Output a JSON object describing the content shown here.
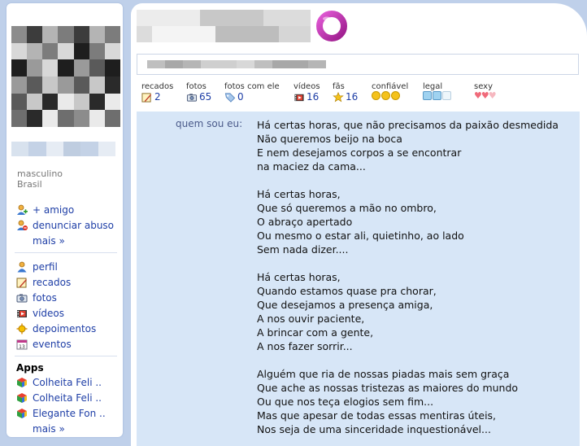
{
  "profile": {
    "gender": "masculino",
    "country": "Brasil"
  },
  "sidebar": {
    "actions": [
      {
        "label": "+ amigo",
        "icon": "add-friend-icon"
      },
      {
        "label": "denunciar abuso",
        "icon": "report-icon"
      },
      {
        "label": "mais »",
        "icon": ""
      }
    ],
    "nav": [
      {
        "label": "perfil",
        "icon": "user-icon"
      },
      {
        "label": "recados",
        "icon": "scrapbook-icon"
      },
      {
        "label": "fotos",
        "icon": "photo-icon"
      },
      {
        "label": "vídeos",
        "icon": "video-icon"
      },
      {
        "label": "depoimentos",
        "icon": "testimonial-icon"
      },
      {
        "label": "eventos",
        "icon": "calendar-icon"
      }
    ],
    "apps_title": "Apps",
    "apps": [
      {
        "label": "Colheita Feli ..",
        "icon": "app-cube-icon"
      },
      {
        "label": "Colheita Feli ..",
        "icon": "app-cube-icon"
      },
      {
        "label": "Elegante Fon ..",
        "icon": "app-cube-icon"
      }
    ],
    "apps_more": "mais »"
  },
  "stats": {
    "recados": {
      "label": "recados",
      "value": "2"
    },
    "fotos": {
      "label": "fotos",
      "value": "65"
    },
    "fotos_com_ele": {
      "label": "fotos com ele",
      "value": "0"
    },
    "videos": {
      "label": "vídeos",
      "value": "16"
    },
    "fas": {
      "label": "fãs",
      "value": "16"
    },
    "confiavel": {
      "label": "confiável",
      "level": 3,
      "max": 3
    },
    "legal": {
      "label": "legal",
      "level": 2,
      "max": 3
    },
    "sexy": {
      "label": "sexy",
      "level": 2.5,
      "max": 3
    }
  },
  "about": {
    "label": "quem sou eu:",
    "lines": [
      "Há certas horas, que não precisamos da paixão desmedida",
      "Não queremos beijo na boca",
      "E nem desejamos corpos a se encontrar",
      "na maciez da cama...",
      "",
      "Há certas horas,",
      "Que só queremos a mão no ombro,",
      "O abraço apertado",
      "Ou mesmo o estar ali, quietinho, ao lado",
      "Sem nada dizer....",
      "",
      "Há certas horas,",
      "Quando estamos quase pra chorar,",
      "Que desejamos a presença amiga,",
      "A nos ouvir paciente,",
      "A brincar com a gente,",
      "A nos fazer sorrir...",
      "",
      "Alguém que ria de nossas piadas mais sem graça",
      "Que ache as nossas tristezas as maiores do mundo",
      "Ou que nos teça elogios sem fim...",
      "Mas que apesar de todas essas mentiras úteis,",
      "Nos seja de uma sinceridade inquestionável..."
    ]
  },
  "colors": {
    "link": "#1e3ea6",
    "background": "#bfd0ea",
    "about_bg": "#d7e6f7",
    "logo": "#c02cb0"
  }
}
